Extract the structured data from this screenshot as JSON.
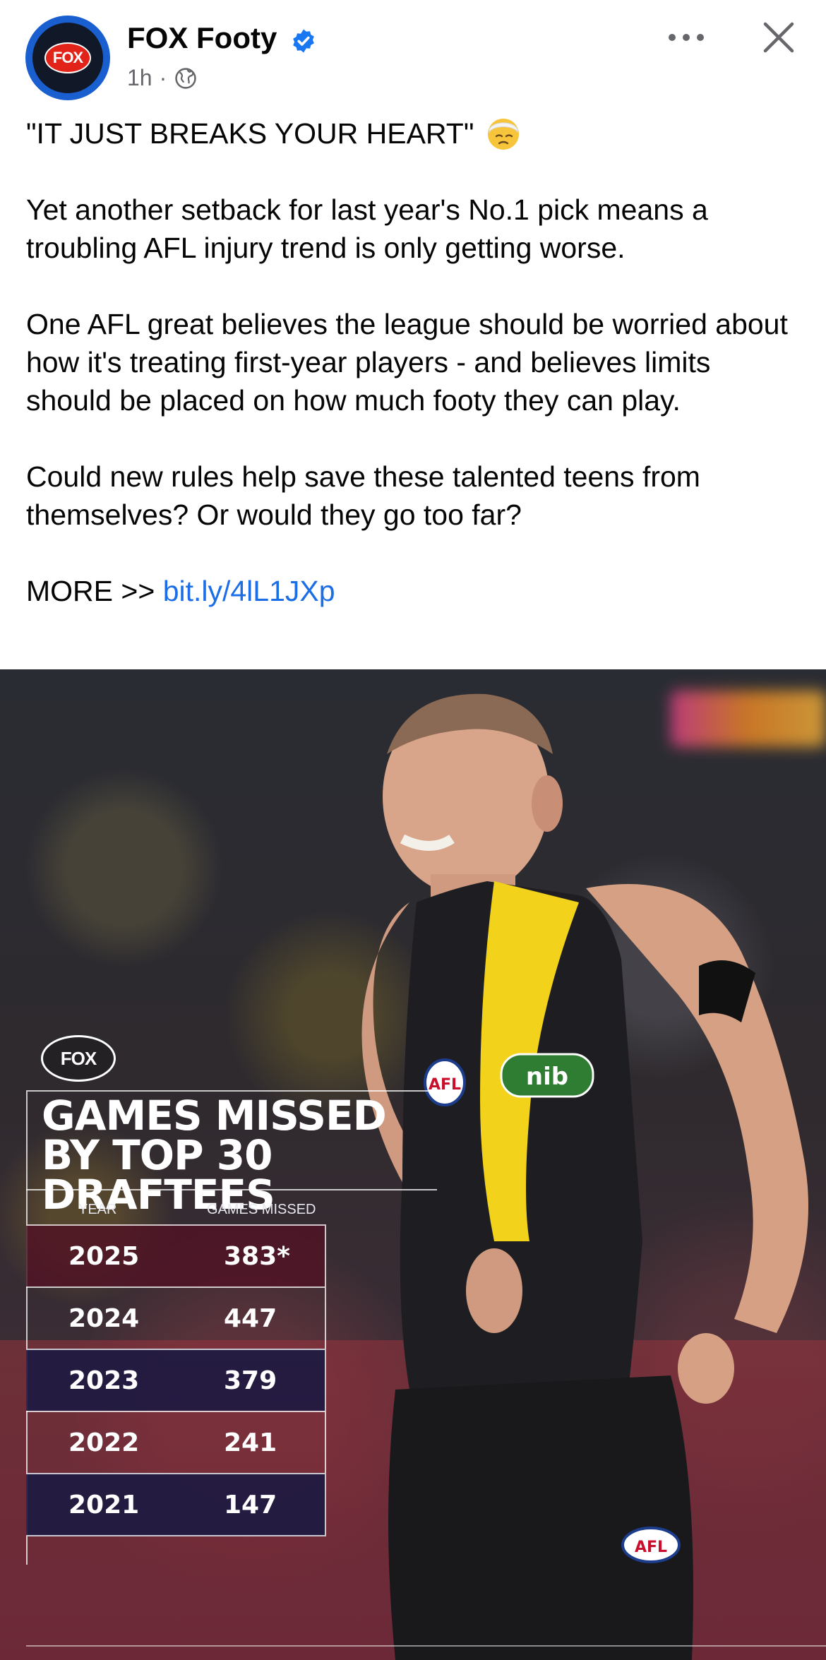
{
  "post": {
    "page_name": "FOX Footy",
    "time": "1h",
    "separator": "·",
    "avatar_logo_text": "FOX",
    "headline": "\"IT JUST BREAKS YOUR HEART\"",
    "para1": "Yet another setback for last year's No.1 pick means a troubling AFL injury trend is only getting worse.",
    "para2": "One AFL great believes the league should be worried about how it's treating first-year players - and believes limits should be placed on how much footy they can play.",
    "para3": "Could new rules help save these talented teens from themselves? Or would they go too far?",
    "more_prefix": "MORE >>",
    "more_link": "bit.ly/4lL1JXp"
  },
  "graphic": {
    "logo_text": "FOX",
    "title": "GAMES MISSED BY TOP 30 DRAFTEES",
    "columns": [
      "YEAR",
      "GAMES MISSED"
    ],
    "rows": [
      {
        "year": "2025",
        "missed": "383*"
      },
      {
        "year": "2024",
        "missed": "447"
      },
      {
        "year": "2023",
        "missed": "379"
      },
      {
        "year": "2022",
        "missed": "241"
      },
      {
        "year": "2021",
        "missed": "147"
      }
    ],
    "sponsor_text": "nib",
    "afl_text": "AFL"
  },
  "colors": {
    "link": "#1b6ee6",
    "verified": "#1877f2",
    "jersey_yellow": "#f2d21b",
    "jersey_black": "#1e1e22"
  }
}
